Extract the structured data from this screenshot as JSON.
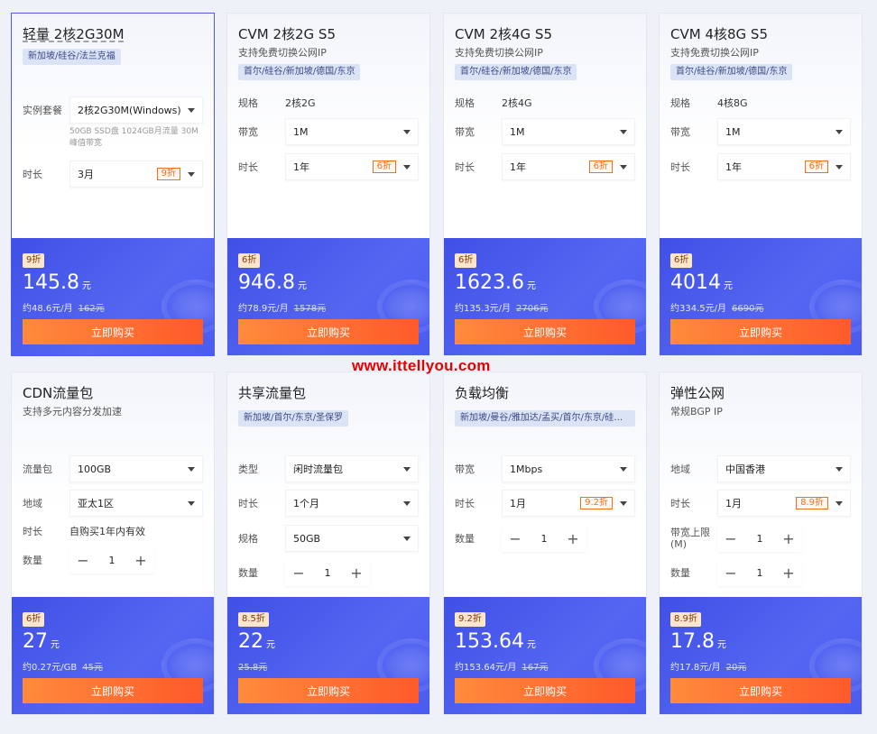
{
  "cards": [
    {
      "title": "轻量 2核2G30M",
      "tag": "新加坡/硅谷/法兰克福",
      "rows": [
        {
          "label": "实例套餐",
          "value": "2核2G30M(Windows)"
        },
        {
          "note": "50GB SSD盘 1024GB月流量 30M峰值带宽"
        },
        {
          "label": "时长",
          "value": "3月",
          "discount": "9折"
        }
      ],
      "badge": "9折",
      "price": "145.8",
      "unit": "元",
      "per": "约48.6元/月",
      "orig": "162元",
      "buy": "立即购买"
    },
    {
      "title": "CVM 2核2G S5",
      "subtitle": "支持免费切换公网IP",
      "tag": "首尔/硅谷/新加坡/德国/东京",
      "rows": [
        {
          "label": "规格",
          "text": "2核2G"
        },
        {
          "label": "带宽",
          "value": "1M"
        },
        {
          "label": "时长",
          "value": "1年",
          "discount": "6折"
        }
      ],
      "badge": "6折",
      "price": "946.8",
      "unit": "元",
      "per": "约78.9元/月",
      "orig": "1578元",
      "buy": "立即购买"
    },
    {
      "title": "CVM 2核4G S5",
      "subtitle": "支持免费切换公网IP",
      "tag": "首尔/硅谷/新加坡/德国/东京",
      "rows": [
        {
          "label": "规格",
          "text": "2核4G"
        },
        {
          "label": "带宽",
          "value": "1M"
        },
        {
          "label": "时长",
          "value": "1年",
          "discount": "6折"
        }
      ],
      "badge": "6折",
      "price": "1623.6",
      "unit": "元",
      "per": "约135.3元/月",
      "orig": "2706元",
      "buy": "立即购买"
    },
    {
      "title": "CVM 4核8G S5",
      "subtitle": "支持免费切换公网IP",
      "tag": "首尔/硅谷/新加坡/德国/东京",
      "rows": [
        {
          "label": "规格",
          "text": "4核8G"
        },
        {
          "label": "带宽",
          "value": "1M"
        },
        {
          "label": "时长",
          "value": "1年",
          "discount": "6折"
        }
      ],
      "badge": "6折",
      "price": "4014",
      "unit": "元",
      "per": "约334.5元/月",
      "orig": "6690元",
      "buy": "立即购买"
    },
    {
      "title": "CDN流量包",
      "subtitle": "支持多元内容分发加速",
      "rows": [
        {
          "label": "流量包",
          "value": "100GB"
        },
        {
          "label": "地域",
          "value": "亚太1区"
        },
        {
          "label": "时长",
          "text": "自购买1年内有效"
        },
        {
          "label": "数量",
          "stepper": "1"
        }
      ],
      "badge": "6折",
      "price": "27",
      "unit": "元",
      "per": "约0.27元/GB",
      "orig": "45元",
      "buy": "立即购买"
    },
    {
      "title": "共享流量包",
      "tag": "新加坡/首尔/东京/圣保罗",
      "rows": [
        {
          "label": "类型",
          "value": "闲时流量包"
        },
        {
          "label": "时长",
          "value": "1个月"
        },
        {
          "label": "规格",
          "value": "50GB"
        },
        {
          "label": "数量",
          "stepper": "1"
        }
      ],
      "badge": "8.5折",
      "price": "22",
      "unit": "元",
      "per": "",
      "orig": "25.8元",
      "buy": "立即购买"
    },
    {
      "title": "负载均衡",
      "tag": "新加坡/曼谷/雅加达/孟买/首尔/东京/硅谷/...",
      "rows": [
        {
          "label": "带宽",
          "value": "1Mbps"
        },
        {
          "label": "时长",
          "value": "1月",
          "discount": "9.2折"
        },
        {
          "label": "数量",
          "stepper": "1"
        }
      ],
      "badge": "9.2折",
      "price": "153.64",
      "unit": "元",
      "per": "约153.64元/月",
      "orig": "167元",
      "buy": "立即购买"
    },
    {
      "title": "弹性公网",
      "subtitle": "常规BGP IP",
      "rows": [
        {
          "label": "地域",
          "value": "中国香港"
        },
        {
          "label": "时长",
          "value": "1月",
          "discount": "8.9折"
        },
        {
          "label": "带宽上限(M)",
          "stepper": "1"
        },
        {
          "label": "数量",
          "stepper": "1"
        }
      ],
      "badge": "8.9折",
      "price": "17.8",
      "unit": "元",
      "per": "约17.8元/月",
      "orig": "20元",
      "buy": "立即购买"
    }
  ],
  "watermark": "www.ittellyou.com"
}
